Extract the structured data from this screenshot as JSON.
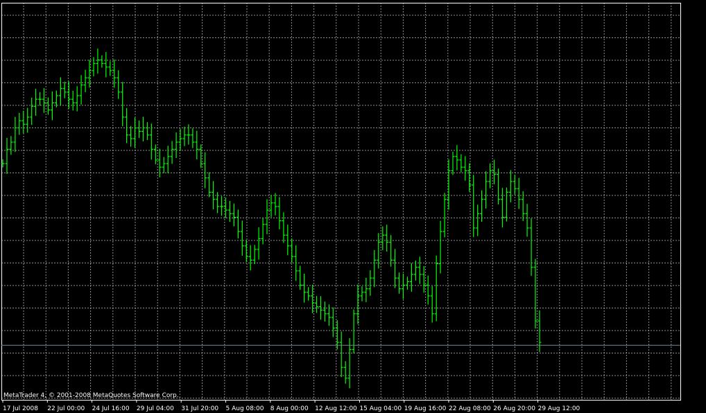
{
  "chart_data": {
    "type": "bar",
    "style": "ohlc-bars",
    "title": "",
    "xlabel": "",
    "ylabel": "",
    "copyright": "MetaTrader 4, © 2001-2008 MetaQuotes Software Corp.",
    "x_tick_labels": [
      "17 Jul 2008",
      "22 Jul 00:00",
      "24 Jul 16:00",
      "29 Jul 04:00",
      "31 Jul 20:00",
      "5 Aug 08:00",
      "8 Aug 00:00",
      "12 Aug 12:00",
      "15 Aug 04:00",
      "19 Aug 16:00",
      "22 Aug 08:00",
      "26 Aug 20:00",
      "29 Aug 12:00"
    ],
    "ylim": [
      0,
      1
    ],
    "price_level": 0.112,
    "grid": true,
    "colors": {
      "background": "#000000",
      "bars": "#00ff00",
      "grid": "#c0c0c0",
      "axis": "#ffffff",
      "price_line": "#778899"
    },
    "series": [
      {
        "values": [
          0.62,
          0.66,
          0.68,
          0.72,
          0.74,
          0.73,
          0.75,
          0.78,
          0.8,
          0.8,
          0.79,
          0.77,
          0.79,
          0.81,
          0.83,
          0.82,
          0.8,
          0.79,
          0.81,
          0.84,
          0.86,
          0.88,
          0.9,
          0.91,
          0.9,
          0.89,
          0.88,
          0.86,
          0.82,
          0.75,
          0.7,
          0.69,
          0.72,
          0.71,
          0.72,
          0.7,
          0.66,
          0.63,
          0.61,
          0.62,
          0.64,
          0.66,
          0.68,
          0.69,
          0.7,
          0.7,
          0.68,
          0.66,
          0.62,
          0.58,
          0.54,
          0.52,
          0.5,
          0.5,
          0.49,
          0.48,
          0.47,
          0.43,
          0.39,
          0.36,
          0.35,
          0.38,
          0.41,
          0.45,
          0.49,
          0.51,
          0.5,
          0.46,
          0.42,
          0.39,
          0.36,
          0.32,
          0.28,
          0.26,
          0.25,
          0.23,
          0.22,
          0.21,
          0.2,
          0.19,
          0.16,
          0.12,
          0.05,
          0.02,
          0.1,
          0.2,
          0.25,
          0.26,
          0.27,
          0.3,
          0.35,
          0.4,
          0.42,
          0.4,
          0.35,
          0.3,
          0.27,
          0.28,
          0.29,
          0.31,
          0.33,
          0.31,
          0.28,
          0.25,
          0.2,
          0.34,
          0.43,
          0.52,
          0.6,
          0.64,
          0.63,
          0.61,
          0.6,
          0.56,
          0.44,
          0.48,
          0.52,
          0.57,
          0.6,
          0.59,
          0.52,
          0.47,
          0.54,
          0.57,
          0.55,
          0.52,
          0.48,
          0.44,
          0.33,
          0.18,
          0.12
        ]
      }
    ]
  }
}
